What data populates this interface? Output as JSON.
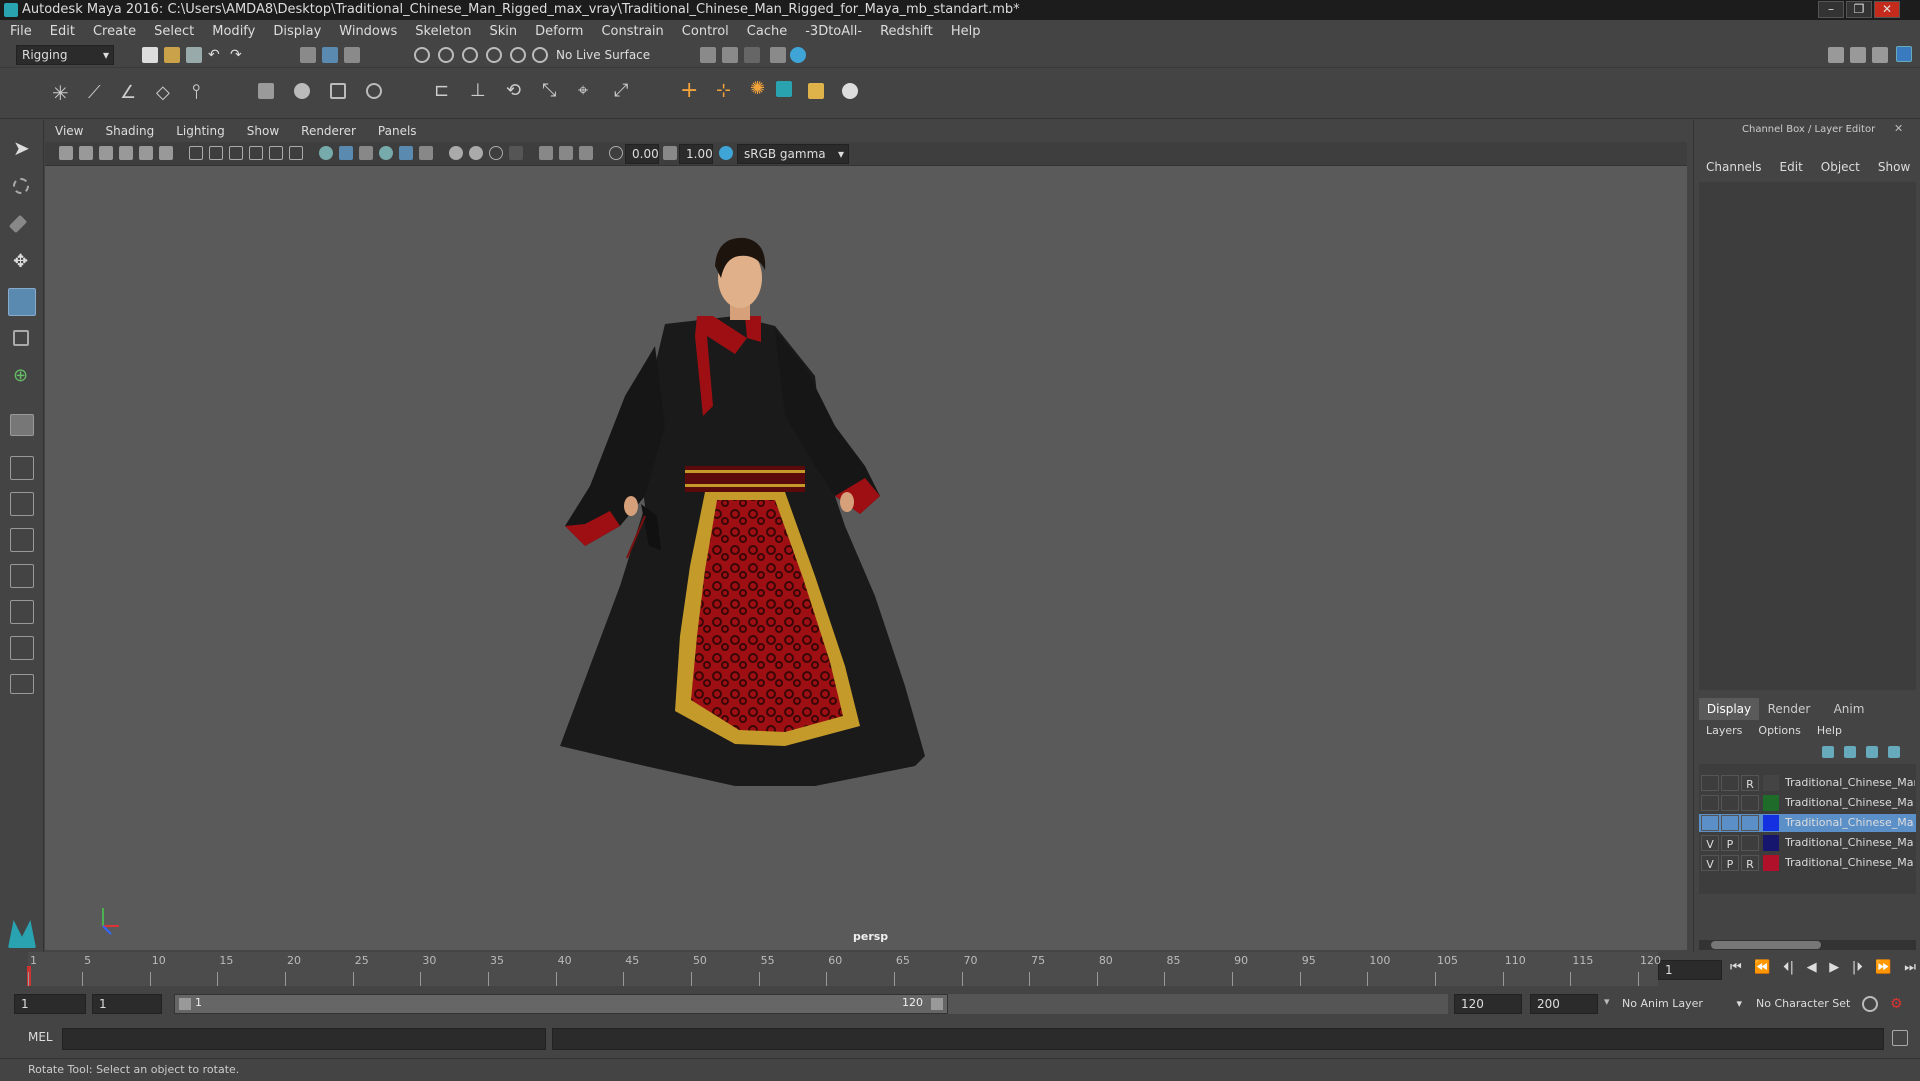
{
  "window": {
    "title": "Autodesk Maya 2016: C:\\Users\\AMDA8\\Desktop\\Traditional_Chinese_Man_Rigged_max_vray\\Traditional_Chinese_Man_Rigged_for_Maya_mb_standart.mb*",
    "controls": [
      "–",
      "❐",
      "✕"
    ]
  },
  "menubar": [
    "File",
    "Edit",
    "Create",
    "Select",
    "Modify",
    "Display",
    "Windows",
    "Skeleton",
    "Skin",
    "Deform",
    "Constrain",
    "Control",
    "Cache",
    "-3DtoAll-",
    "Redshift",
    "Help"
  ],
  "toolbar": {
    "mode": "Rigging",
    "live_surface": "No Live Surface"
  },
  "viewport": {
    "menu": [
      "View",
      "Shading",
      "Lighting",
      "Show",
      "Renderer",
      "Panels"
    ],
    "exposure": "0.00",
    "gamma": "1.00",
    "color_space": "sRGB gamma",
    "camera_label": "persp"
  },
  "channel_box": {
    "title": "Channel Box / Layer Editor",
    "menu": [
      "Channels",
      "Edit",
      "Object",
      "Show"
    ]
  },
  "layer_editor": {
    "tabs": [
      "Display",
      "Render",
      "Anim"
    ],
    "active_tab": "Display",
    "menu": [
      "Layers",
      "Options",
      "Help"
    ],
    "layers": [
      {
        "v": "",
        "p": "",
        "r": "R",
        "color": "#444444",
        "name": "Traditional_Chinese_Man_l",
        "selected": false
      },
      {
        "v": "",
        "p": "",
        "r": "",
        "color": "#1f6b2a",
        "name": "Traditional_Chinese_Ma",
        "selected": false
      },
      {
        "v": "",
        "p": "",
        "r": "",
        "color": "#1530e0",
        "name": "Traditional_Chinese_Ma",
        "selected": true
      },
      {
        "v": "V",
        "p": "P",
        "r": "",
        "color": "#16166e",
        "name": "Traditional_Chinese_Ma",
        "selected": false
      },
      {
        "v": "V",
        "p": "P",
        "r": "R",
        "color": "#b0102a",
        "name": "Traditional_Chinese_Ma",
        "selected": false
      }
    ]
  },
  "timeline": {
    "ticks": [
      "1",
      "5",
      "10",
      "15",
      "20",
      "25",
      "30",
      "35",
      "40",
      "45",
      "50",
      "55",
      "60",
      "65",
      "70",
      "75",
      "80",
      "85",
      "90",
      "95",
      "100",
      "105",
      "110",
      "115",
      "120"
    ],
    "current_frame": "1",
    "playback": [
      "⏮",
      "⏪",
      "⏴|",
      "◀",
      "▶",
      "|⏵",
      "⏩",
      "⏭"
    ]
  },
  "range": {
    "start": "1",
    "playback_start": "1",
    "slider_start": "1",
    "slider_end": "120",
    "playback_end": "120",
    "end": "200",
    "anim_layer": "No Anim Layer",
    "character_set": "No Character Set"
  },
  "mel": {
    "label": "MEL"
  },
  "status": "Rotate Tool: Select an object to rotate."
}
